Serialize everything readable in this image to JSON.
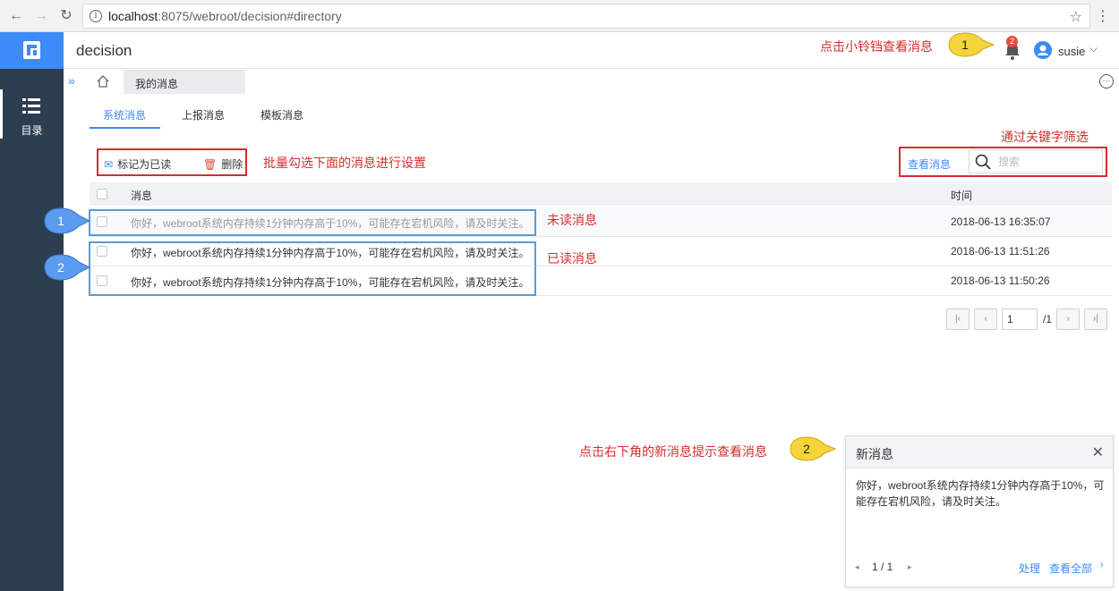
{
  "browser": {
    "url_host": "localhost",
    "url_rest": ":8075/webroot/decision#directory"
  },
  "sidebar": {
    "items": [
      {
        "label": "目录",
        "icon": "list-icon"
      }
    ]
  },
  "header": {
    "title": "decision",
    "badge_count": "2",
    "username": "susie"
  },
  "tabs": {
    "my_messages": "我的消息"
  },
  "message_tabs": [
    {
      "label": "系统消息",
      "active": true
    },
    {
      "label": "上报消息",
      "active": false
    },
    {
      "label": "模板消息",
      "active": false
    }
  ],
  "toolbar": {
    "mark_read": "标记为已读",
    "delete": "删除",
    "view_messages": "查看消息",
    "search_placeholder": "搜索"
  },
  "table": {
    "columns": [
      "消息",
      "时间"
    ],
    "rows": [
      {
        "message": "你好，webroot系统内存持续1分钟内存高于10%，可能存在宕机风险，请及时关注。",
        "time": "2018-06-13 16:35:07",
        "unread": true
      },
      {
        "message": "你好，webroot系统内存持续1分钟内存高于10%，可能存在宕机风险，请及时关注。",
        "time": "2018-06-13 11:51:26",
        "unread": false
      },
      {
        "message": "你好，webroot系统内存持续1分钟内存高于10%，可能存在宕机风险，请及时关注。",
        "time": "2018-06-13 11:50:26",
        "unread": false
      }
    ]
  },
  "pagination": {
    "current": "1",
    "total": "/1"
  },
  "annotations": {
    "bell_hint": "点击小铃铛查看消息",
    "batch_hint": "批量勾选下面的消息进行设置",
    "filter_hint": "通过关键字筛选",
    "unread_label": "未读消息",
    "read_label": "已读消息",
    "popup_hint": "点击右下角的新消息提示查看消息",
    "callout_1": "1",
    "callout_2": "2"
  },
  "notification": {
    "title": "新消息",
    "body": "你好，webroot系统内存持续1分钟内存高于10%，可能存在宕机风险，请及时关注。",
    "page": "1 / 1",
    "handle": "处理",
    "view_all": "查看全部"
  },
  "colors": {
    "accent": "#3d8bf7",
    "sidebar": "#2d3e50",
    "annotation_red": "#d62c2c",
    "callout_yellow": "#f5d33a",
    "callout_blue": "#5b9bf0"
  }
}
